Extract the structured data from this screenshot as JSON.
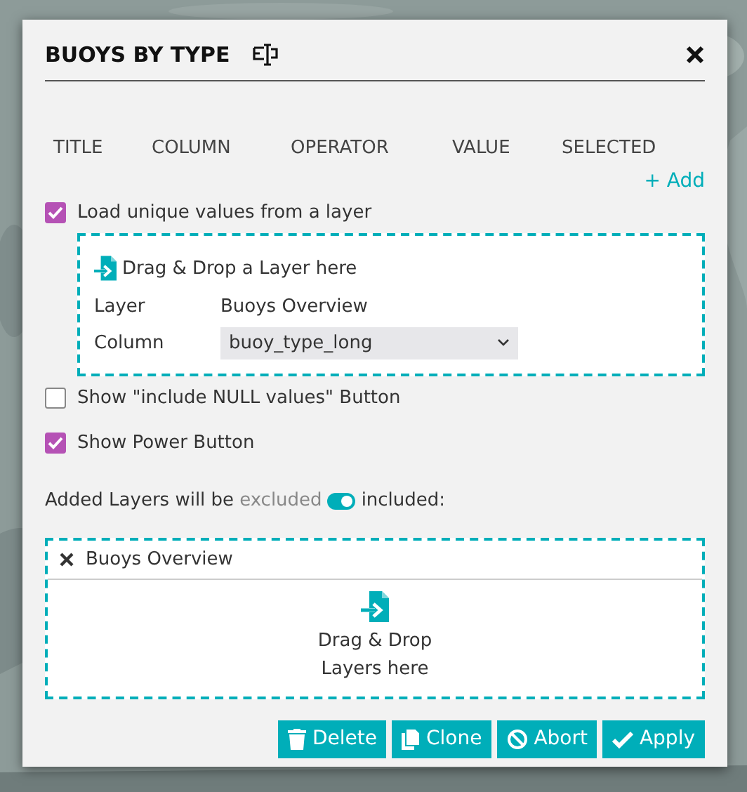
{
  "dialog": {
    "title": "BUOYS BY TYPE",
    "columns": [
      "TITLE",
      "COLUMN",
      "OPERATOR",
      "VALUE",
      "SELECTED"
    ],
    "add_link": "+ Add",
    "load_unique": {
      "label": "Load unique values from a layer",
      "checked": true,
      "drop_zone": {
        "text": "Drag & Drop a Layer here",
        "layer_label": "Layer",
        "layer_value": "Buoys Overview",
        "column_label": "Column",
        "column_value": "buoy_type_long"
      }
    },
    "options": [
      {
        "label": "Show \"include NULL values\" Button",
        "checked": false
      },
      {
        "label": "Show Power Button",
        "checked": true
      }
    ],
    "layer_mode": {
      "prefix": "Added Layers will be",
      "off_label": "excluded",
      "on_label": "included:",
      "on": true
    },
    "added_layers": [
      {
        "name": "Buoys Overview"
      }
    ],
    "drop_lines": [
      "Drag & Drop",
      "Layers here"
    ],
    "buttons": [
      {
        "label": "Delete",
        "kind": "delete"
      },
      {
        "label": "Clone",
        "kind": "clone"
      },
      {
        "label": "Abort",
        "kind": "abort"
      },
      {
        "label": "Apply",
        "kind": "apply"
      }
    ]
  }
}
